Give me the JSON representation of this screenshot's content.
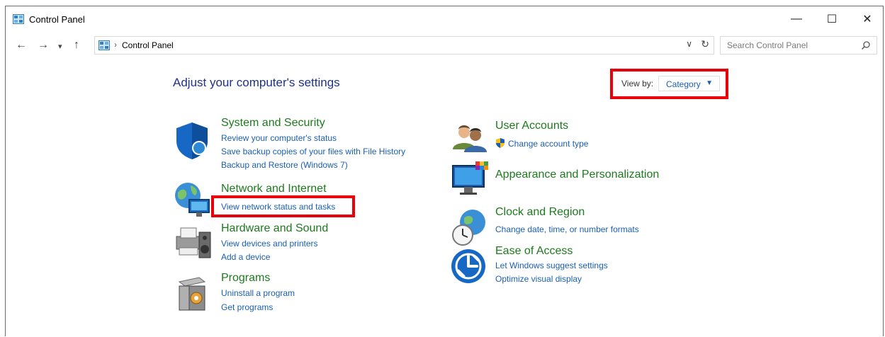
{
  "window": {
    "title": "Control Panel",
    "minimize_glyph": "—",
    "maximize_glyph": "☐",
    "close_glyph": "✕"
  },
  "nav": {
    "back_glyph": "←",
    "forward_glyph": "→",
    "recent_glyph": "▾",
    "up_glyph": "↑"
  },
  "address": {
    "separator": "›",
    "path": "Control Panel",
    "dropdown_glyph": "∨",
    "refresh_glyph": "↻"
  },
  "search": {
    "placeholder": "Search Control Panel"
  },
  "main": {
    "heading": "Adjust your computer's settings",
    "view_by": {
      "label": "View by:",
      "value": "Category",
      "arrow": "▼"
    },
    "categories": [
      {
        "title": "System and Security",
        "icon": "system-security-shield-icon",
        "links": [
          "Review your computer's status",
          "Save backup copies of your files with File History",
          "Backup and Restore (Windows 7)"
        ]
      },
      {
        "title": "Network and Internet",
        "icon": "network-globe-icon",
        "links": [
          "View network status and tasks"
        ]
      },
      {
        "title": "Hardware and Sound",
        "icon": "printer-speaker-icon",
        "links": [
          "View devices and printers",
          "Add a device"
        ]
      },
      {
        "title": "Programs",
        "icon": "programs-box-icon",
        "links": [
          "Uninstall a program",
          "Get programs"
        ]
      },
      {
        "title": "User Accounts",
        "icon": "users-icon",
        "links": [
          "Change account type"
        ]
      },
      {
        "title": "Appearance and Personalization",
        "icon": "monitor-palette-icon",
        "links": []
      },
      {
        "title": "Clock and Region",
        "icon": "clock-globe-icon",
        "links": [
          "Change date, time, or number formats"
        ]
      },
      {
        "title": "Ease of Access",
        "icon": "ease-of-access-icon",
        "links": [
          "Let Windows suggest settings",
          "Optimize visual display"
        ]
      }
    ]
  },
  "colors": {
    "heading": "#1e3287",
    "category_title": "#1d7a1d",
    "link": "#1a5fb4",
    "highlight": "#e8000b"
  }
}
